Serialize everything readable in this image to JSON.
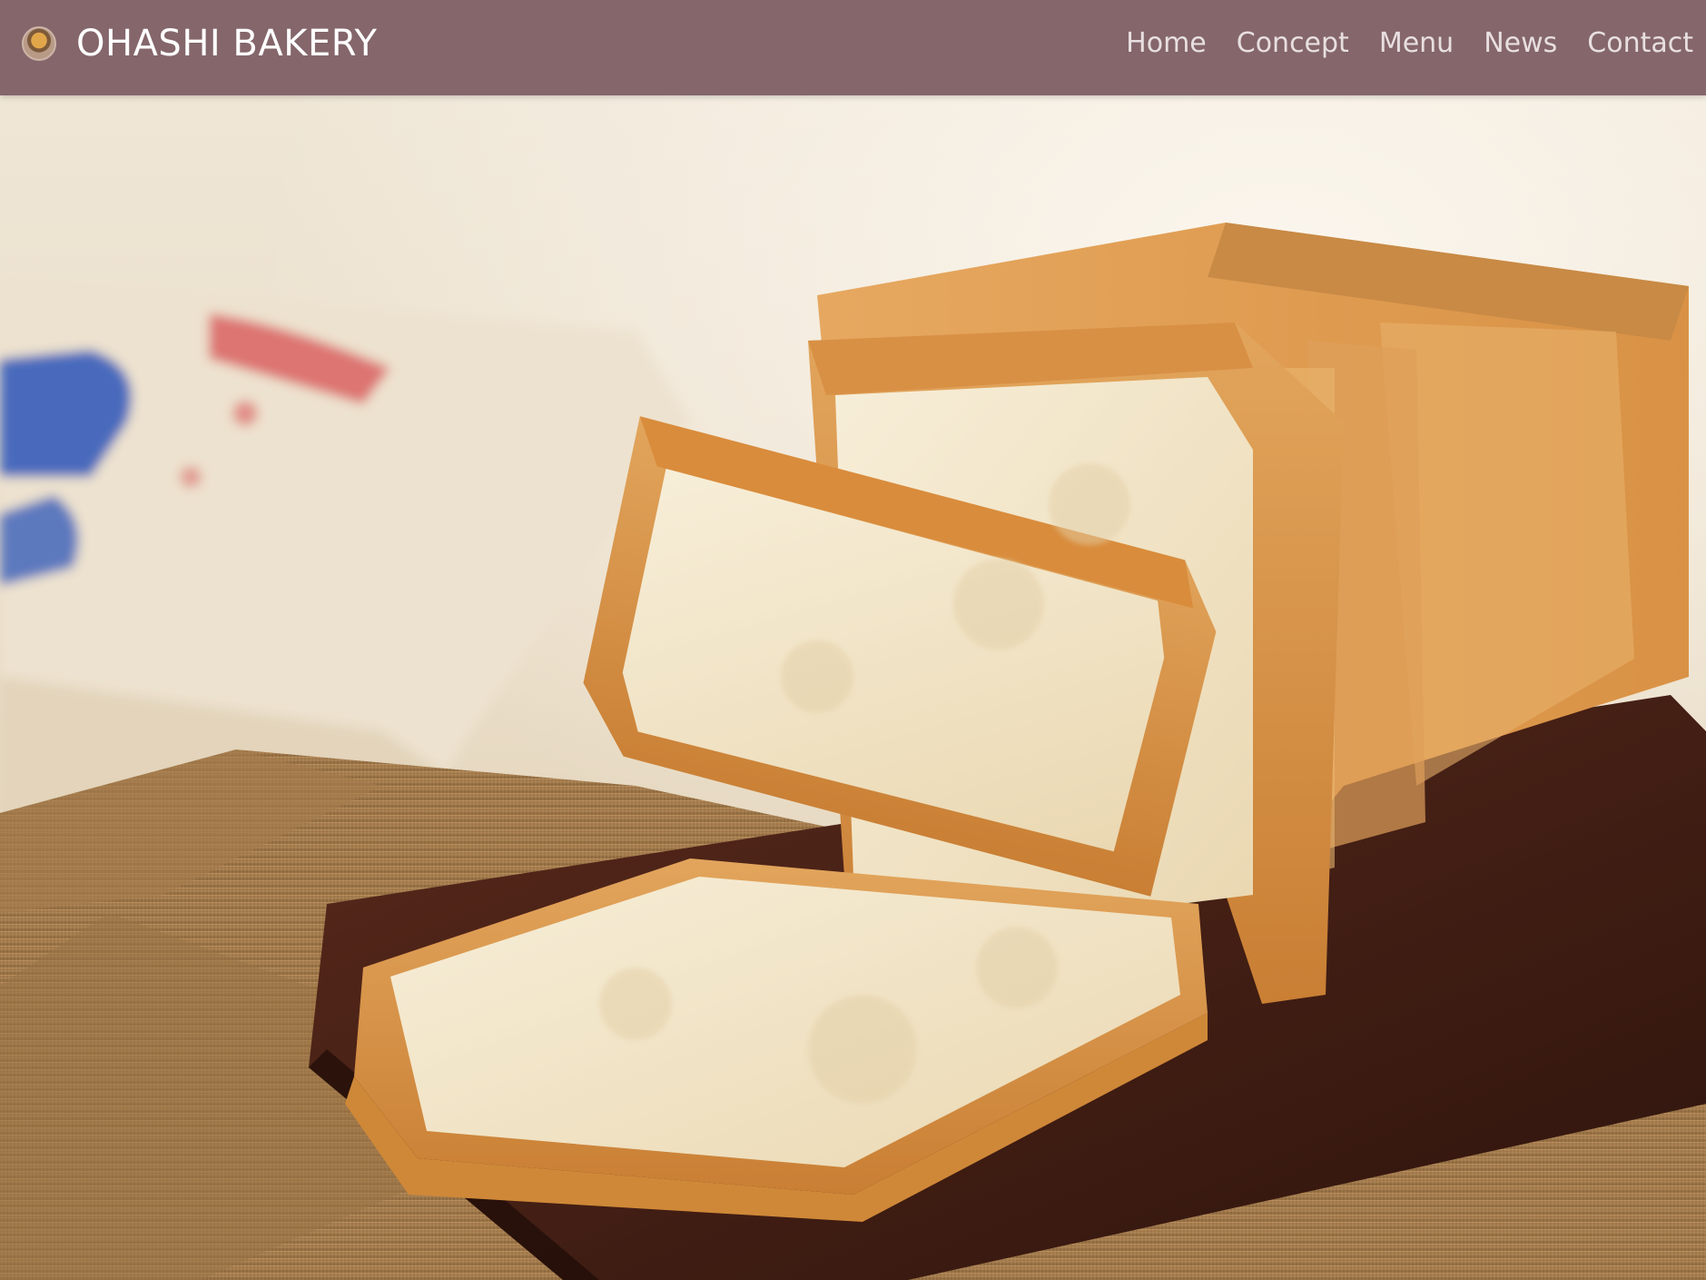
{
  "header": {
    "brand": {
      "name": "OHASHI BAKERY",
      "logo_icon": "bakery-logo-icon"
    },
    "nav": [
      {
        "label": "Home"
      },
      {
        "label": "Concept"
      },
      {
        "label": "Menu"
      },
      {
        "label": "News"
      },
      {
        "label": "Contact"
      }
    ]
  },
  "hero": {
    "image": "hero-bread-photo"
  },
  "colors": {
    "header_bg": "#84666b",
    "nav_text": "#e8dfe0",
    "brand_text": "#ffffff"
  }
}
